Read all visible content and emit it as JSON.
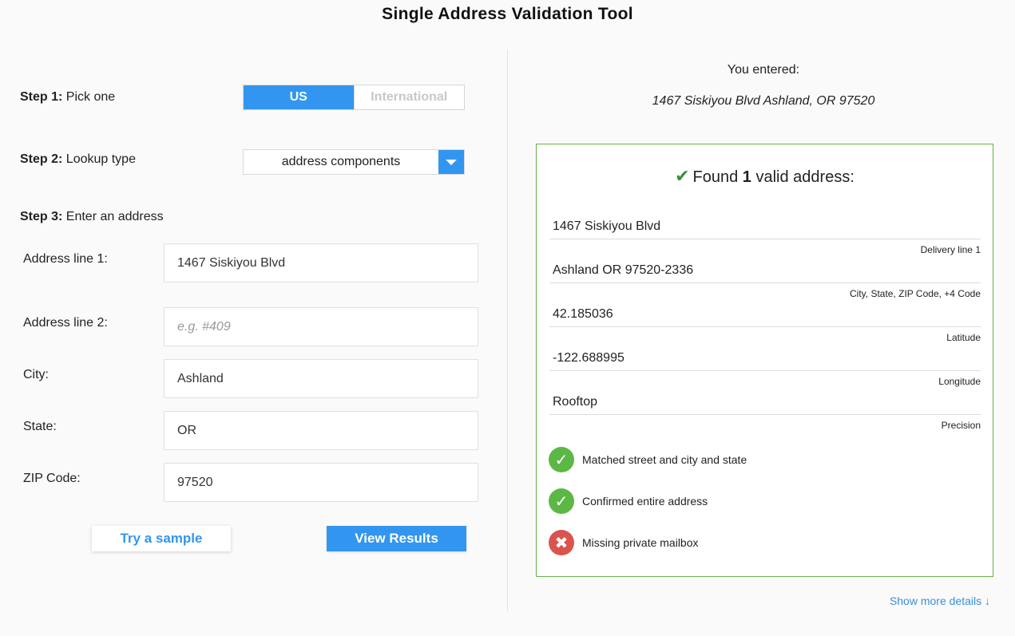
{
  "title": "Single Address Validation Tool",
  "step1": {
    "strong": "Step 1:",
    "text": " Pick one",
    "options": [
      "US",
      "International"
    ],
    "selected": "US"
  },
  "step2": {
    "strong": "Step 2:",
    "text": " Lookup type",
    "selected": "address components"
  },
  "step3": {
    "strong": "Step 3:",
    "text": " Enter an address"
  },
  "fields": {
    "address1": {
      "label": "Address line 1:",
      "value": "1467 Siskiyou Blvd"
    },
    "address2": {
      "label": "Address line 2:",
      "placeholder": "e.g. #409",
      "value": ""
    },
    "city": {
      "label": "City:",
      "value": "Ashland"
    },
    "state": {
      "label": "State:",
      "value": "OR"
    },
    "zip": {
      "label": "ZIP Code:",
      "value": "97520"
    }
  },
  "buttons": {
    "sample": "Try a sample",
    "view": "View Results"
  },
  "result": {
    "entered_label": "You entered:",
    "entered_address": "1467 Siskiyou Blvd Ashland, OR 97520",
    "found_prefix": "Found ",
    "found_count": "1",
    "found_suffix": " valid address:",
    "rows": [
      {
        "value": "1467 Siskiyou Blvd",
        "caption": "Delivery line 1"
      },
      {
        "value": "Ashland OR 97520-2336",
        "caption": "City, State, ZIP Code, +4 Code"
      },
      {
        "value": "42.185036",
        "caption": "Latitude"
      },
      {
        "value": "-122.688995",
        "caption": "Longitude"
      },
      {
        "value": "Rooftop",
        "caption": "Precision"
      }
    ],
    "statuses": [
      {
        "text": "Matched street and city and state",
        "ok": true
      },
      {
        "text": "Confirmed entire address",
        "ok": true
      },
      {
        "text": "Missing private mailbox",
        "ok": false
      }
    ],
    "more_link": "Show more details ↓"
  },
  "colors": {
    "accent": "#3296f0",
    "success": "#5cb844",
    "error": "#d9534f",
    "box_border": "#6ab04c"
  }
}
